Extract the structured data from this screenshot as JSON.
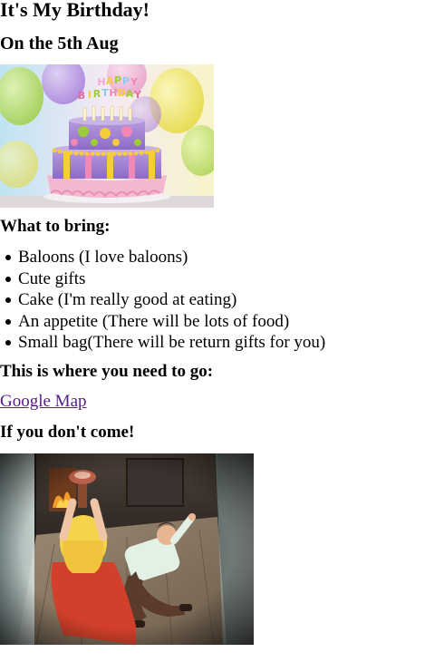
{
  "page": {
    "title": "It's My Birthday!",
    "date_line": "On the 5th Aug"
  },
  "cake_image": {
    "cake_topper_text": "HAPPY BIRTHDAY"
  },
  "bring": {
    "heading": "What to bring:",
    "items": [
      "Baloons (I love baloons)",
      "Cute gifts",
      "Cake (I'm really good at eating)",
      "An appetite (There will be lots of food)",
      "Small bag(There will be return gifts for you)"
    ]
  },
  "location": {
    "heading": "This is where you need to go:",
    "link_text": "Google Map"
  },
  "warning": {
    "heading": "If you don't come!"
  },
  "colors": {
    "link_visited": "#551a8b",
    "text": "#000000",
    "background": "#ffffff"
  }
}
